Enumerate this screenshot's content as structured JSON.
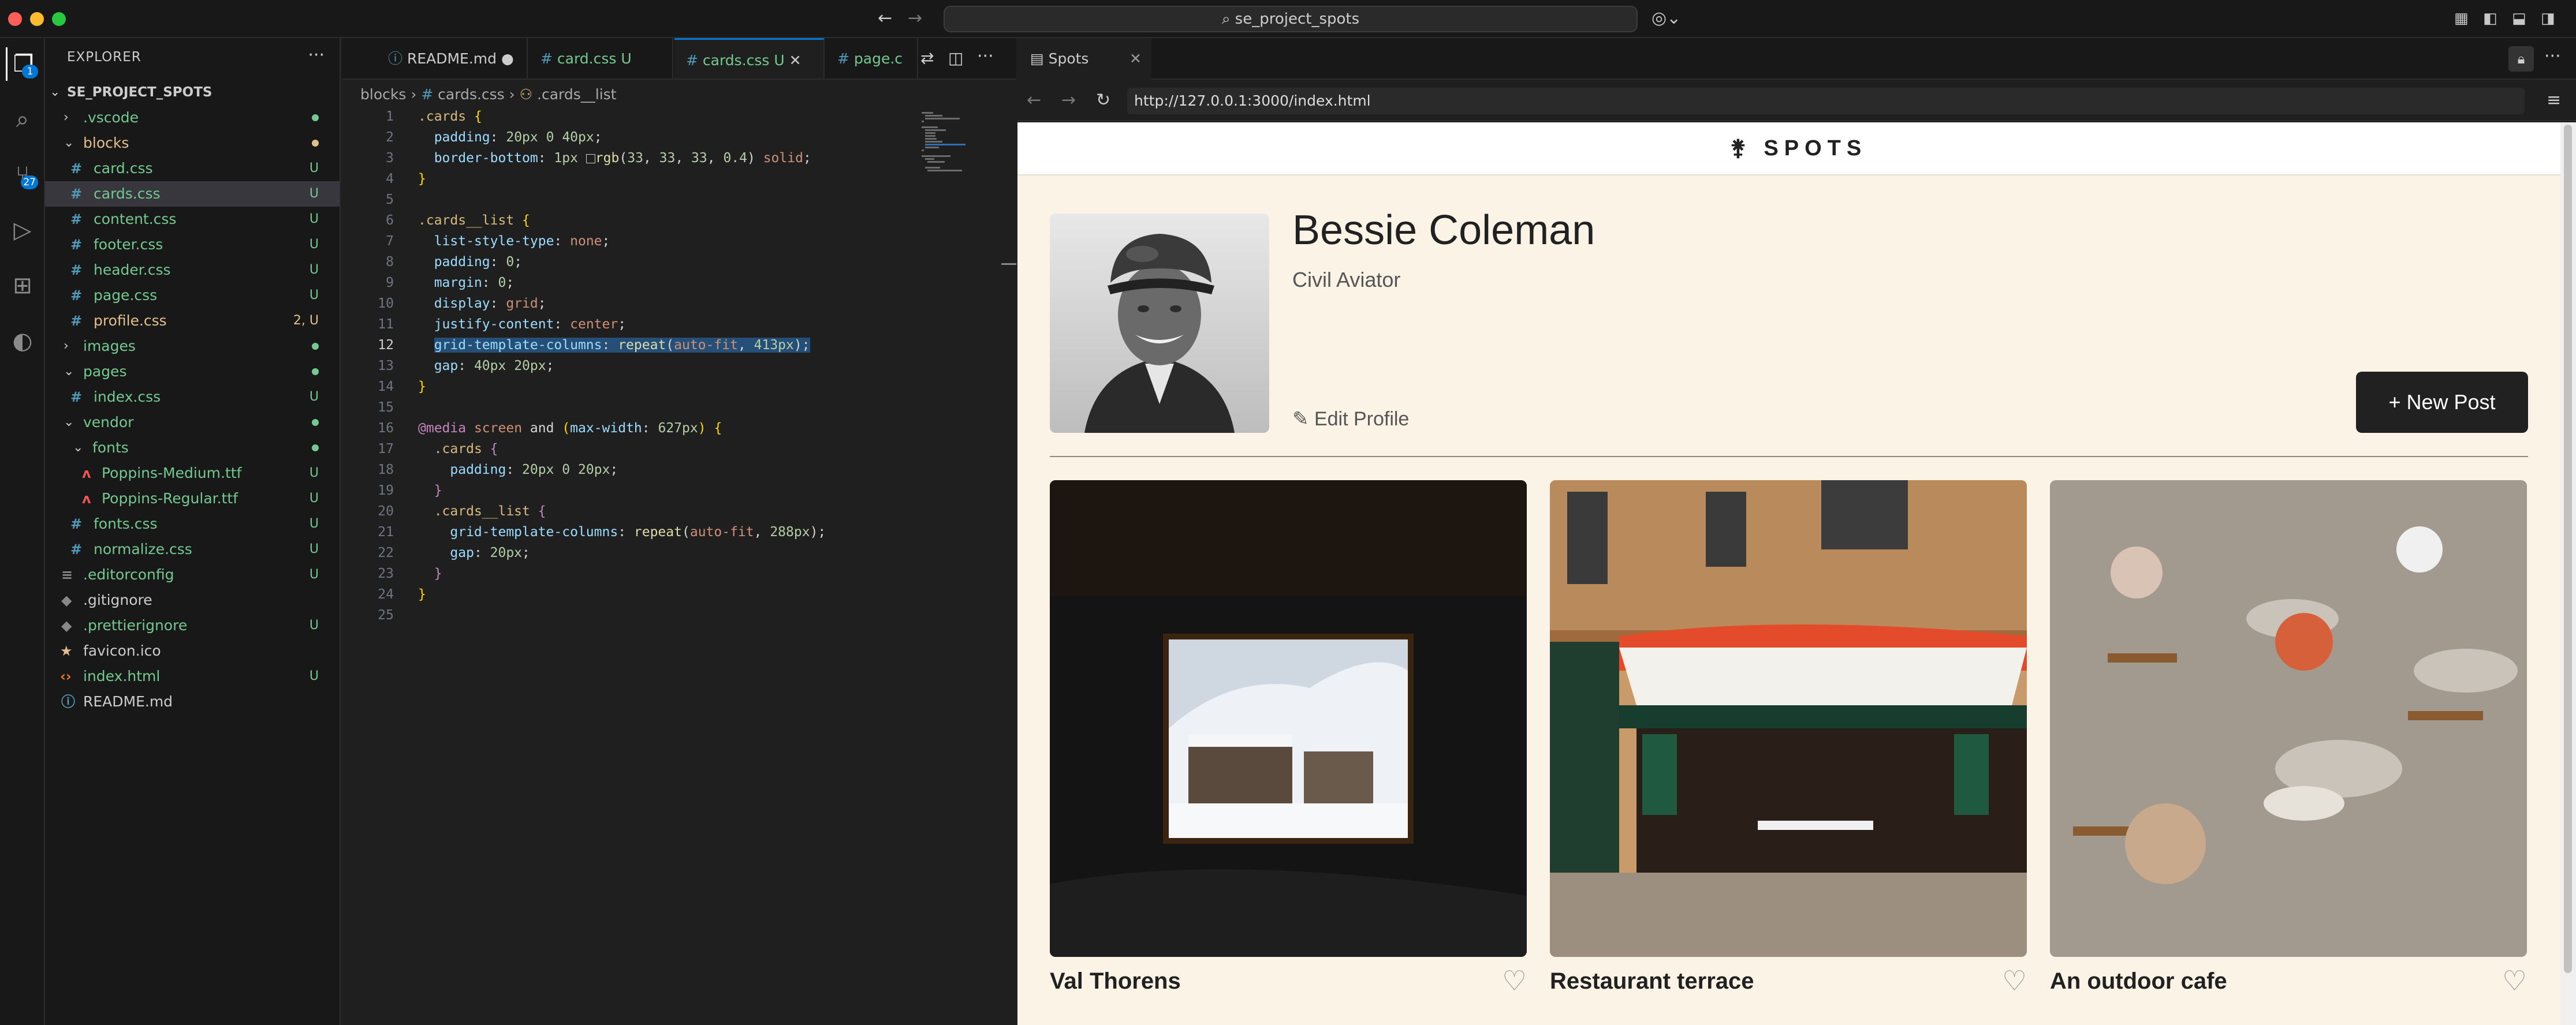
{
  "titlebar": {
    "search_text": "se_project_spots"
  },
  "activity": {
    "source_control_badge": "27",
    "explorer_badge": "1"
  },
  "explorer": {
    "title": "EXPLORER",
    "root": "SE_PROJECT_SPOTS",
    "items": [
      {
        "label": ".vscode",
        "status": ""
      },
      {
        "label": "blocks",
        "status": ""
      },
      {
        "label": "card.css",
        "status": "U"
      },
      {
        "label": "cards.css",
        "status": "U"
      },
      {
        "label": "content.css",
        "status": "U"
      },
      {
        "label": "footer.css",
        "status": "U"
      },
      {
        "label": "header.css",
        "status": "U"
      },
      {
        "label": "page.css",
        "status": "U"
      },
      {
        "label": "profile.css",
        "status": "2, U"
      },
      {
        "label": "images",
        "status": ""
      },
      {
        "label": "pages",
        "status": ""
      },
      {
        "label": "index.css",
        "status": "U"
      },
      {
        "label": "vendor",
        "status": ""
      },
      {
        "label": "fonts",
        "status": ""
      },
      {
        "label": "Poppins-Medium.ttf",
        "status": "U"
      },
      {
        "label": "Poppins-Regular.ttf",
        "status": "U"
      },
      {
        "label": "fonts.css",
        "status": "U"
      },
      {
        "label": "normalize.css",
        "status": "U"
      },
      {
        "label": ".editorconfig",
        "status": "U"
      },
      {
        "label": ".gitignore",
        "status": ""
      },
      {
        "label": ".prettierignore",
        "status": "U"
      },
      {
        "label": "favicon.ico",
        "status": ""
      },
      {
        "label": "index.html",
        "status": "U"
      },
      {
        "label": "README.md",
        "status": ""
      }
    ]
  },
  "tabs": [
    {
      "label": "README.md",
      "status": ""
    },
    {
      "label": "card.css",
      "status": "U"
    },
    {
      "label": "cards.css",
      "status": "U"
    },
    {
      "label": "page.c",
      "status": ""
    }
  ],
  "breadcrumb": {
    "folder": "blocks",
    "file": "cards.css",
    "symbol": ".cards__list"
  },
  "browser": {
    "tab_title": "Spots",
    "url": "http://127.0.0.1:3000/index.html",
    "logo": "SPOTS",
    "profile": {
      "name": "Bessie Coleman",
      "job": "Civil Aviator",
      "edit_label": "Edit Profile",
      "new_post_label": "New Post"
    },
    "cards": [
      {
        "title": "Val Thorens"
      },
      {
        "title": "Restaurant terrace"
      },
      {
        "title": "An outdoor cafe"
      }
    ]
  },
  "colors": {
    "accent": "#0078d4",
    "untracked": "#73c991",
    "page_bg": "#fbf4e6",
    "button_bg": "#212121"
  }
}
